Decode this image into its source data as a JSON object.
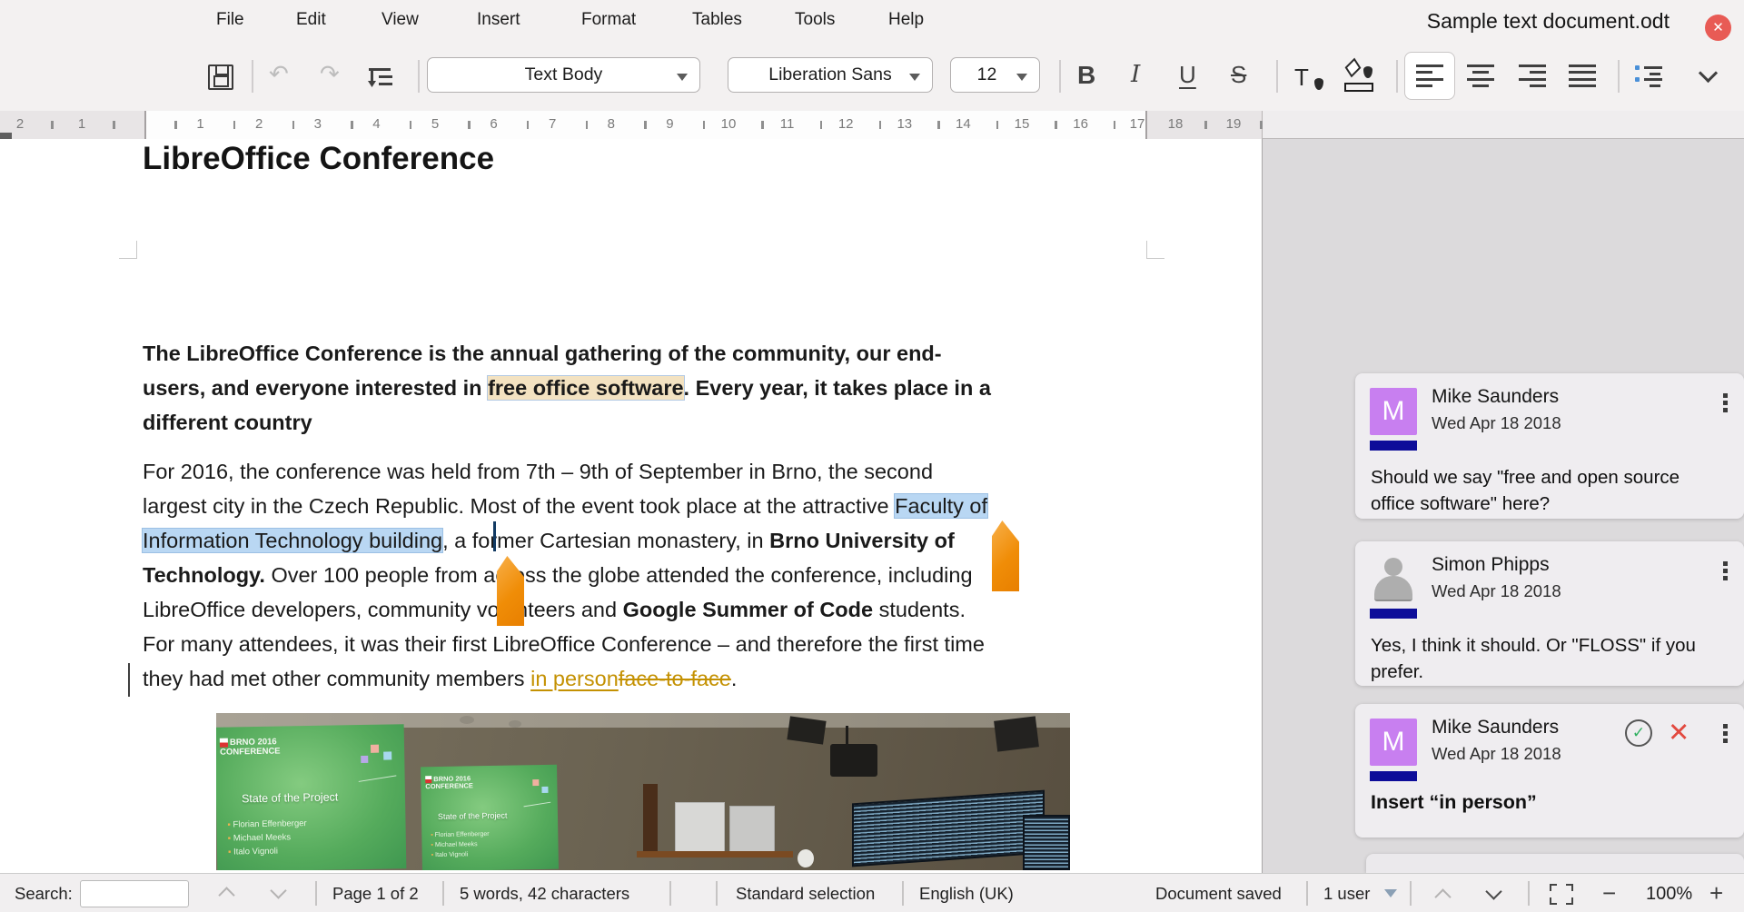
{
  "window": {
    "title": "Sample text document.odt",
    "close_label": "✕"
  },
  "menu": {
    "items": [
      "File",
      "Edit",
      "View",
      "Insert",
      "Format",
      "Tables",
      "Tools",
      "Help"
    ]
  },
  "toolbar": {
    "paragraph_style": "Text Body",
    "font_name": "Liberation Sans",
    "font_size": "12",
    "bold_label": "B",
    "italic_label": "I",
    "underline_label": "U",
    "strikethrough_label": "S",
    "font_color_label": "T"
  },
  "ruler": {
    "left": [
      "2",
      "1"
    ],
    "main": [
      "1",
      "2",
      "3",
      "4",
      "5",
      "6",
      "7",
      "8",
      "9",
      "10",
      "11",
      "12",
      "13",
      "14",
      "15",
      "16",
      "17"
    ],
    "right": [
      "18",
      "19"
    ]
  },
  "document": {
    "title": "LibreOffice Conference",
    "intro_lines": [
      [
        {
          "t": "The LibreOffice Conference is the annual gathering of the community, our end-",
          "s": "n"
        }
      ],
      [
        {
          "t": "users, and everyone interested in ",
          "s": "n"
        },
        {
          "t": "free office software",
          "s": "hl"
        },
        {
          "t": ". Every year, it takes place in a",
          "s": "n"
        }
      ],
      [
        {
          "t": "different country",
          "s": "n"
        }
      ]
    ],
    "body_lines": [
      [
        {
          "t": "For 2016, the conference was held from 7th – 9th of September in Brno, the second",
          "s": "n"
        }
      ],
      [
        {
          "t": "largest city in the Czech Republic. Most of the event took place at the attractive ",
          "s": "n"
        },
        {
          "t": "Faculty of",
          "s": "sel"
        }
      ],
      [
        {
          "t": "Information Technology building",
          "s": "sel"
        },
        {
          "t": ", a former Cartesian monastery, in ",
          "s": "n"
        },
        {
          "t": "Brno University of",
          "s": "b"
        }
      ],
      [
        {
          "t": "Technology.",
          "s": "b"
        },
        {
          "t": " Over 100 people from across the globe attended the conference, including",
          "s": "n"
        }
      ],
      [
        {
          "t": "LibreOffice developers, community volunteers and ",
          "s": "n"
        },
        {
          "t": "Google Summer of Code",
          "s": "b"
        },
        {
          "t": " students.",
          "s": "n"
        }
      ],
      [
        {
          "t": "For many attendees, it was their first LibreOffice Conference – and therefore the first time",
          "s": "n"
        }
      ],
      [
        {
          "t": "they had met other community members ",
          "s": "n"
        },
        {
          "t": "in person",
          "s": "ins"
        },
        {
          "t": "face-to-face",
          "s": "del"
        },
        {
          "t": ".",
          "s": "n"
        }
      ]
    ],
    "photo": {
      "banner_line1": "BRNO 2016",
      "banner_line2": "CONFERENCE",
      "slide_title": "State of the Project",
      "bullets": [
        "Florian Effenberger",
        "Michael Meeks",
        "Italo Vignoli"
      ]
    }
  },
  "comments": [
    {
      "avatar_letter": "M",
      "name": "Mike Saunders",
      "date": "Wed Apr 18 2018",
      "text": "Should we say \"free and open source office software\" here?"
    },
    {
      "avatar_letter": "",
      "name": "Simon Phipps",
      "date": "Wed Apr 18 2018",
      "text": "Yes, I think it should. Or \"FLOSS\" if you prefer."
    },
    {
      "avatar_letter": "M",
      "name": "Mike Saunders",
      "date": "Wed Apr 18 2018",
      "text": "Insert “in person”",
      "accept_label": "✓",
      "reject_label": "✕"
    }
  ],
  "status": {
    "search_label": "Search:",
    "search_value": "",
    "page": "Page 1 of 2",
    "words": "5 words, 42 characters",
    "selection_mode": "Standard selection",
    "language": "English (UK)",
    "saved": "Document saved",
    "users": "1 user",
    "zoom_out": "−",
    "zoom_level": "100%",
    "zoom_in": "+"
  },
  "colors": {
    "close_red": "#e85b55",
    "selection_blue": "#b9d7f3",
    "comment_anchor_beige": "#f3e2c1",
    "track_change_orange": "#c49102",
    "collab_cursor_orange": "#f08d07",
    "avatar_purple": "#c87ff0",
    "comment_author_bar_navy": "#0d0d99",
    "list_icon_blue": "#4a90d8"
  }
}
